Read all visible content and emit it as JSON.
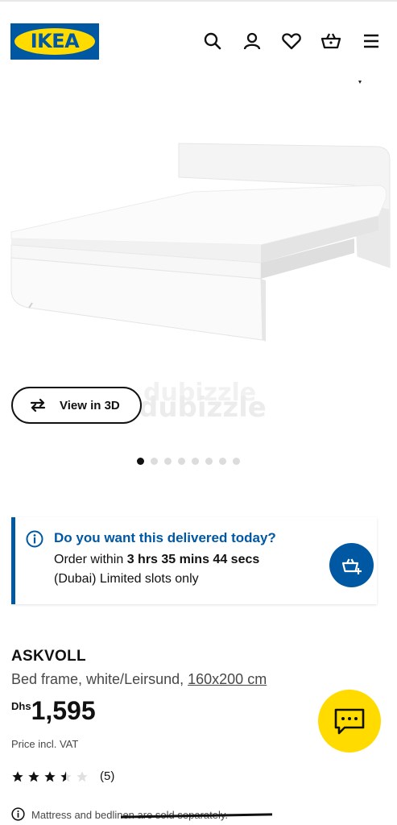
{
  "header": {
    "logo_text": "IKEA",
    "brand_colors": {
      "blue": "#0058a3",
      "yellow": "#ffdb00"
    },
    "icons": [
      "search-icon",
      "profile-icon",
      "heart-icon",
      "basket-icon",
      "menu-icon"
    ]
  },
  "gallery": {
    "view_3d_label": "View in 3D",
    "dot_count": 8,
    "active_dot": 1,
    "watermark": "dubizzle"
  },
  "delivery": {
    "title": "Do you want this delivered today?",
    "order_prefix": "Order within ",
    "countdown": "3 hrs 35 mins 44 secs",
    "slots_text": "(Dubai) Limited slots only",
    "accent": "#0058a3"
  },
  "product": {
    "name": "ASKVOLL",
    "description": "Bed frame, white/Leirsund, ",
    "size": "160x200 cm",
    "currency": "Dhs",
    "price": "1,595",
    "vat_note": "Price incl. VAT",
    "rating_value": 3.5,
    "rating_max": 5,
    "review_count": "(5)",
    "note": "Mattress and bedlinen are sold separately."
  }
}
